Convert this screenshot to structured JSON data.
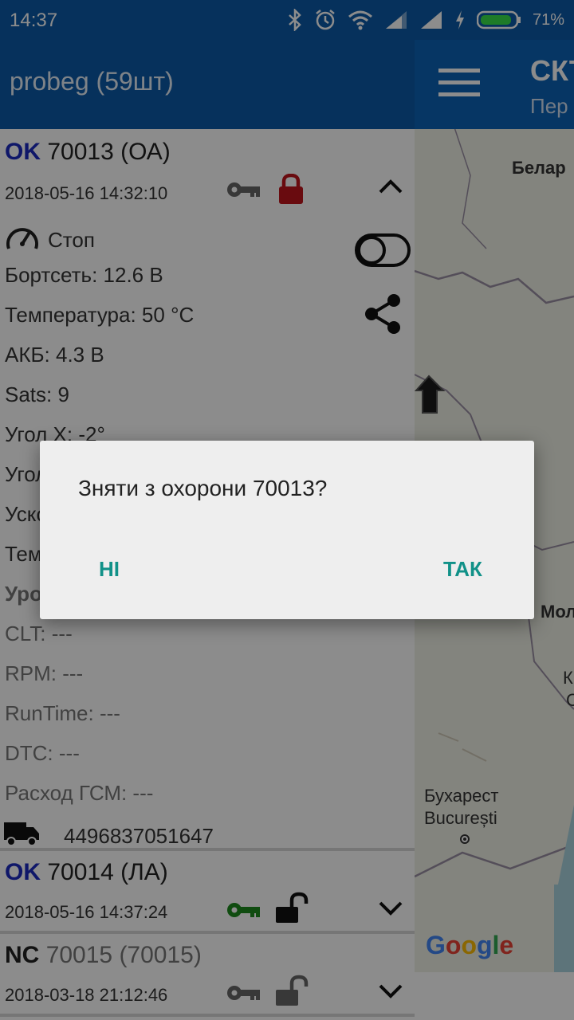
{
  "statusbar": {
    "time": "14:37",
    "battery_pct": "71%"
  },
  "header": {
    "title": "probeg (59шт)"
  },
  "map": {
    "title": "СКТ",
    "subtitle": "Пер",
    "labels": [
      "Белар",
      "Мол",
      "К",
      "С",
      "Бухарест",
      "București"
    ],
    "google": "Google"
  },
  "items": [
    {
      "status": "OK",
      "title": "70013 (ОА)",
      "date": "2018-05-16 14:32:10",
      "motion": "Стоп",
      "details": [
        "Бортсеть: 12.6 В",
        "Температура: 50 °C",
        "АКБ: 4.3 В",
        "Sats: 9",
        "Угол X: -2°",
        "Угол Y: ---",
        "Ускорение: ---",
        "Температура: ---",
        "Уровень: ---",
        "CLT: ---",
        "RPM: ---",
        "RunTime: ---",
        "DTC: ---",
        "Расход ГСМ: ---"
      ],
      "phone": "4496837051647"
    },
    {
      "status": "OK",
      "title": "70014 (ЛА)",
      "date": "2018-05-16 14:37:24"
    },
    {
      "status": "NC",
      "title": "70015 (70015)",
      "date": "2018-03-18 21:12:46"
    }
  ],
  "dialog": {
    "message": "Зняти з охорони 70013?",
    "no_label": "НІ",
    "yes_label": "ТАК"
  },
  "colors": {
    "primary": "#0c5aa8",
    "ok": "#1c2bbf",
    "lock_red": "#c0141c",
    "key_green": "#1e8a1e",
    "dialog_button": "#119188"
  }
}
